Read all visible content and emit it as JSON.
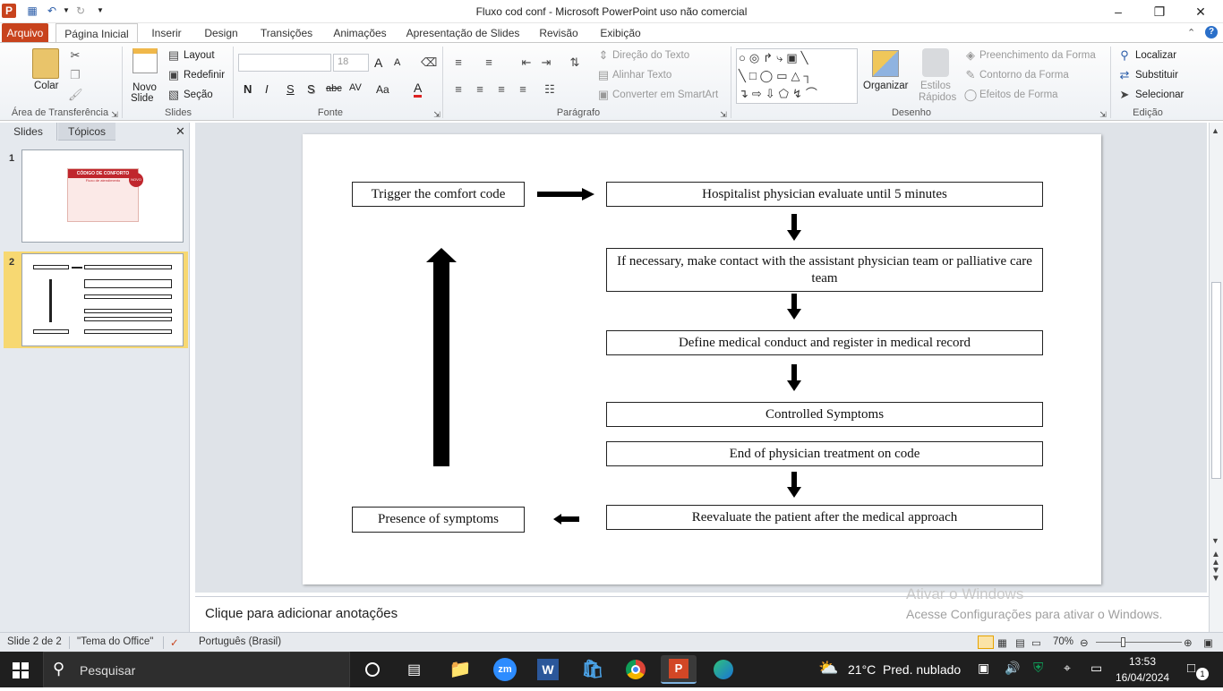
{
  "window": {
    "title": "Fluxo cod conf  -  Microsoft PowerPoint uso não comercial"
  },
  "ribbon_tabs": [
    {
      "label": "Arquivo"
    },
    {
      "label": "Página Inicial"
    },
    {
      "label": "Inserir"
    },
    {
      "label": "Design"
    },
    {
      "label": "Transições"
    },
    {
      "label": "Animações"
    },
    {
      "label": "Apresentação de Slides"
    },
    {
      "label": "Revisão"
    },
    {
      "label": "Exibição"
    }
  ],
  "ribbon": {
    "clipboard": {
      "paste": "Colar",
      "group": "Área de Transferência"
    },
    "slides": {
      "new_slide_1": "Novo",
      "new_slide_2": "Slide",
      "layout": "Layout",
      "reset": "Redefinir",
      "section": "Seção",
      "group": "Slides"
    },
    "font": {
      "size": "18",
      "bold": "N",
      "italic": "I",
      "underline": "S",
      "shadow": "S",
      "strike": "abc",
      "spacing": "AV",
      "case": "Aa",
      "color": "A",
      "grow": "A",
      "shrink": "A",
      "group": "Fonte"
    },
    "paragraph": {
      "text_direction": "Direção do Texto",
      "align_text": "Alinhar Texto",
      "smartart": "Converter em SmartArt",
      "group": "Parágrafo"
    },
    "drawing": {
      "arrange": "Organizar",
      "quick_styles_1": "Estilos",
      "quick_styles_2": "Rápidos",
      "fill": "Preenchimento da Forma",
      "outline": "Contorno da Forma",
      "effects": "Efeitos de Forma",
      "group": "Desenho"
    },
    "editing": {
      "find": "Localizar",
      "replace": "Substituir",
      "select": "Selecionar",
      "group": "Edição"
    }
  },
  "panel": {
    "tab_slides": "Slides",
    "tab_topics": "Tópicos",
    "thumbnails": [
      {
        "number": "1",
        "title": "CÓDIGO DE CONFORTO",
        "subtitle": "Fluxo de atendimento",
        "badge": "NOVO"
      },
      {
        "number": "2"
      }
    ]
  },
  "slide": {
    "boxes": [
      {
        "text": "Trigger the comfort code"
      },
      {
        "text": "Hospitalist physician evaluate until 5 minutes"
      },
      {
        "text": "If necessary, make contact with the assistant physician team or palliative care team"
      },
      {
        "text": "Define medical conduct and register in medical record"
      },
      {
        "text": "Controlled Symptoms"
      },
      {
        "text": "End of physician treatment on code"
      },
      {
        "text": "Reevaluate the patient after the medical approach"
      },
      {
        "text": "Presence of symptoms"
      }
    ]
  },
  "notes": {
    "placeholder": "Clique para adicionar anotações",
    "watermark_1": "Ativar o Windows",
    "watermark_2": "Acesse Configurações para ativar o Windows."
  },
  "status": {
    "slide_counter": "Slide 2 de 2",
    "theme": "\"Tema do Office\"",
    "language": "Português (Brasil)",
    "zoom": "70%"
  },
  "taskbar": {
    "search": "Pesquisar",
    "zoom_app": "zm",
    "weather_temp": "21°C",
    "weather_desc": "Pred. nublado",
    "time": "13:53",
    "date": "16/04/2024",
    "notifications": "1"
  },
  "colors": {
    "arquivo_tab": "#c8431d",
    "taskbar": "#1f1f1f",
    "selected_thumb": "#f7d872"
  }
}
